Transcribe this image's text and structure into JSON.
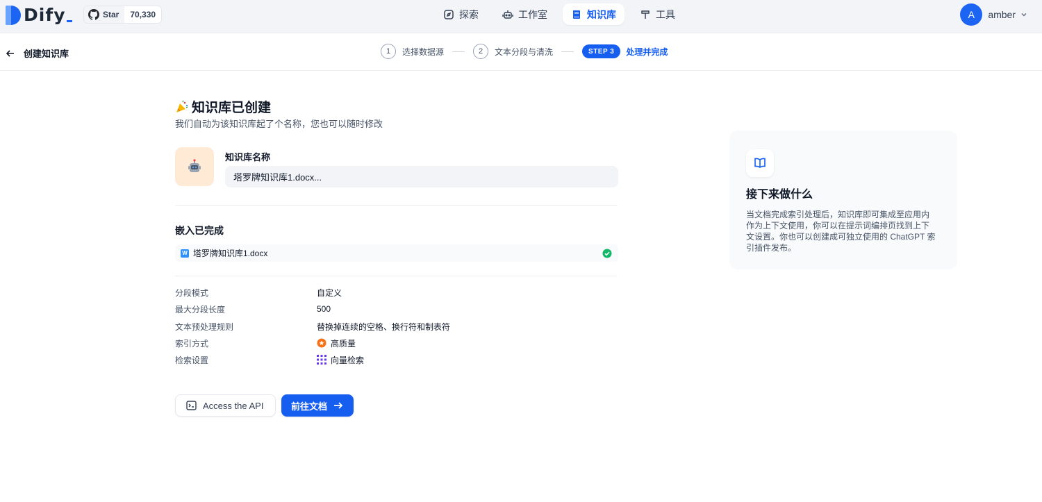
{
  "app": {
    "name": "Dify",
    "github": {
      "star_label": "Star",
      "star_count": "70,330"
    }
  },
  "nav": {
    "items": [
      {
        "label": "探索",
        "icon": "compass-icon",
        "active": false
      },
      {
        "label": "工作室",
        "icon": "robot-icon",
        "active": false
      },
      {
        "label": "知识库",
        "icon": "book-icon",
        "active": true
      },
      {
        "label": "工具",
        "icon": "hammer-icon",
        "active": false
      }
    ]
  },
  "user": {
    "avatar_letter": "A",
    "name": "amber"
  },
  "header": {
    "back_label": "创建知识库",
    "steps": [
      {
        "num": "1",
        "label": "选择数据源"
      },
      {
        "num": "2",
        "label": "文本分段与清洗"
      },
      {
        "pill": "STEP 3",
        "label": "处理并完成"
      }
    ]
  },
  "main": {
    "title": "知识库已创建",
    "subtitle": "我们自动为该知识库起了个名称，您也可以随时修改",
    "kb_name_label": "知识库名称",
    "kb_name_value": "塔罗牌知识库1.docx...",
    "embed_title": "嵌入已完成",
    "file_name": "塔罗牌知识库1.docx",
    "info": [
      {
        "key": "分段模式",
        "value": "自定义"
      },
      {
        "key": "最大分段长度",
        "value": "500"
      },
      {
        "key": "文本预处理规则",
        "value": "替换掉连续的空格、换行符和制表符"
      },
      {
        "key": "索引方式",
        "value": "高质量",
        "icon": "quality-icon"
      },
      {
        "key": "检索设置",
        "value": "向量检索",
        "icon": "vector-grid-icon"
      }
    ],
    "api_button": "Access the API",
    "go_button": "前往文档"
  },
  "side_card": {
    "title": "接下来做什么",
    "text": "当文档完成索引处理后，知识库即可集成至应用内作为上下文使用，你可以在提示词编排页找到上下文设置。你也可以创建成可独立使用的 ChatGPT 索引插件发布。"
  },
  "colors": {
    "accent": "#155eef",
    "success": "#12b76a",
    "quality": "#f97316",
    "vector": "#6938ef"
  }
}
